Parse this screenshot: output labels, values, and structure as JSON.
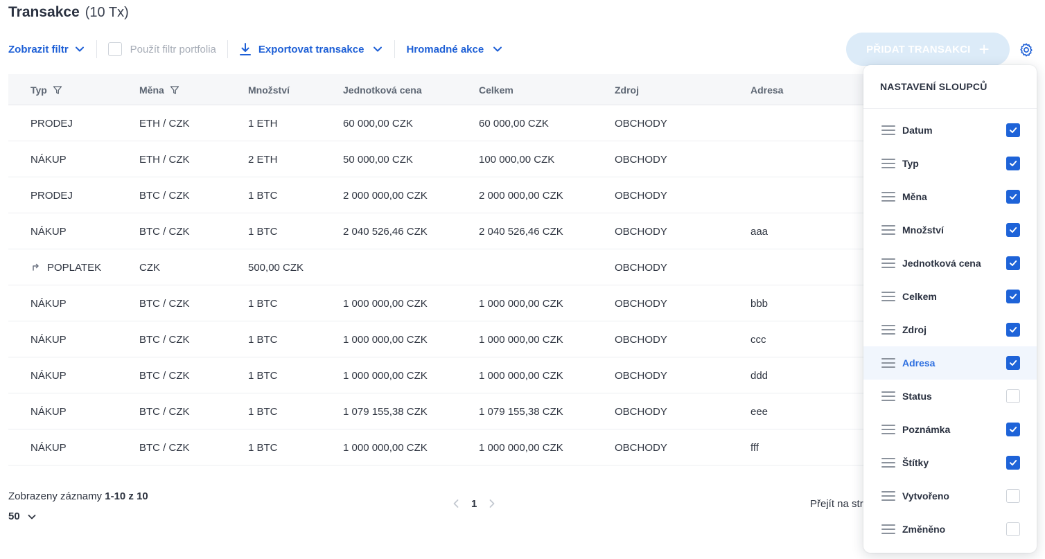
{
  "header": {
    "title": "Transakce",
    "count": "(10 Tx)"
  },
  "toolbar": {
    "show_filter": "Zobrazit filtr",
    "use_portfolio_filter": "Použít filtr portfolia",
    "export": "Exportovat transakce",
    "bulk": "Hromadné akce",
    "add_transaction": "PŘIDAT TRANSAKCI",
    "colors": {
      "accent": "#1d5fd6",
      "add_bg": "#dcebf8"
    }
  },
  "table": {
    "columns": [
      "Typ",
      "Měna",
      "Množství",
      "Jednotková cena",
      "Celkem",
      "Zdroj",
      "Adresa"
    ],
    "rows": [
      [
        "PRODEJ",
        "ETH / CZK",
        "1 ETH",
        "60 000,00 CZK",
        "60 000,00 CZK",
        "OBCHODY",
        ""
      ],
      [
        "NÁKUP",
        "ETH / CZK",
        "2 ETH",
        "50 000,00 CZK",
        "100 000,00 CZK",
        "OBCHODY",
        ""
      ],
      [
        "PRODEJ",
        "BTC / CZK",
        "1 BTC",
        "2 000 000,00 CZK",
        "2 000 000,00 CZK",
        "OBCHODY",
        ""
      ],
      [
        "NÁKUP",
        "BTC / CZK",
        "1 BTC",
        "2 040 526,46 CZK",
        "2 040 526,46 CZK",
        "OBCHODY",
        "aaa"
      ],
      [
        "POPLATEK",
        "CZK",
        "500,00 CZK",
        "",
        "",
        "OBCHODY",
        ""
      ],
      [
        "NÁKUP",
        "BTC / CZK",
        "1 BTC",
        "1 000 000,00 CZK",
        "1 000 000,00 CZK",
        "OBCHODY",
        "bbb"
      ],
      [
        "NÁKUP",
        "BTC / CZK",
        "1 BTC",
        "1 000 000,00 CZK",
        "1 000 000,00 CZK",
        "OBCHODY",
        "ccc"
      ],
      [
        "NÁKUP",
        "BTC / CZK",
        "1 BTC",
        "1 000 000,00 CZK",
        "1 000 000,00 CZK",
        "OBCHODY",
        "ddd"
      ],
      [
        "NÁKUP",
        "BTC / CZK",
        "1 BTC",
        "1 079 155,38 CZK",
        "1 079 155,38 CZK",
        "OBCHODY",
        "eee"
      ],
      [
        "NÁKUP",
        "BTC / CZK",
        "1 BTC",
        "1 000 000,00 CZK",
        "1 000 000,00 CZK",
        "OBCHODY",
        "fff"
      ]
    ]
  },
  "footer": {
    "shown_prefix": "Zobrazeny záznamy",
    "shown_range": "1-10 z 10",
    "page_size": "50",
    "current_page": "1",
    "goto_label": "Přejít na str"
  },
  "column_settings": {
    "title": "NASTAVENÍ SLOUPCŮ",
    "items": [
      {
        "label": "Datum",
        "checked": true
      },
      {
        "label": "Typ",
        "checked": true
      },
      {
        "label": "Měna",
        "checked": true
      },
      {
        "label": "Množství",
        "checked": true
      },
      {
        "label": "Jednotková cena",
        "checked": true
      },
      {
        "label": "Celkem",
        "checked": true
      },
      {
        "label": "Zdroj",
        "checked": true
      },
      {
        "label": "Adresa",
        "checked": true,
        "highlighted": true
      },
      {
        "label": "Status",
        "checked": false
      },
      {
        "label": "Poznámka",
        "checked": true
      },
      {
        "label": "Štítky",
        "checked": true
      },
      {
        "label": "Vytvořeno",
        "checked": false
      },
      {
        "label": "Změněno",
        "checked": false
      }
    ]
  }
}
